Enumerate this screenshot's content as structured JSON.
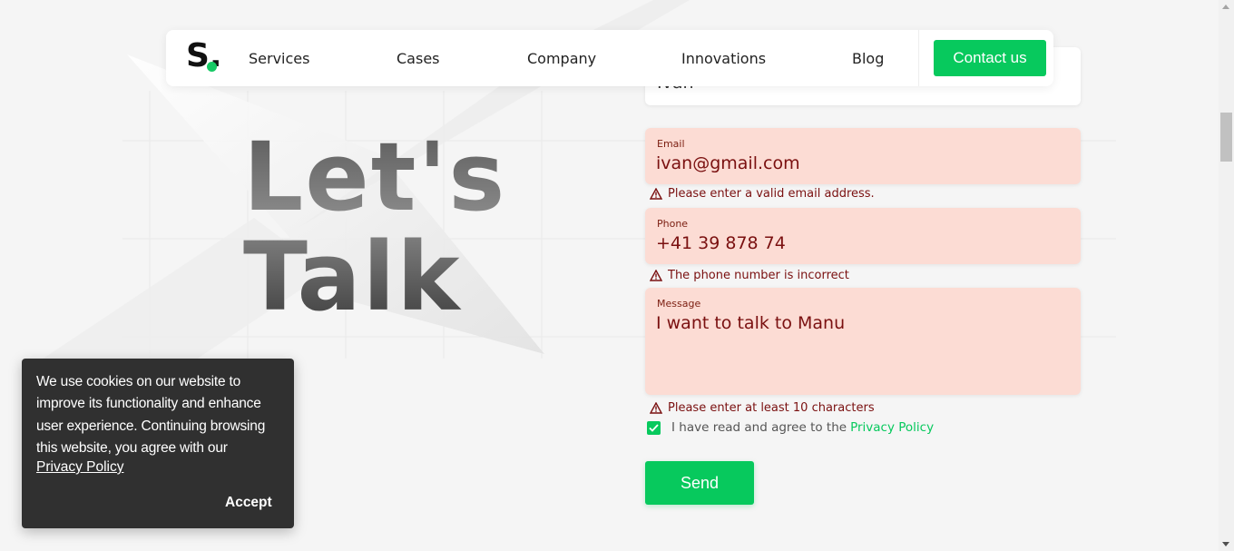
{
  "colors": {
    "accent": "#07c95d",
    "error_bg": "#fcdcd4",
    "error_text": "#7a1010",
    "cookie_bg": "#303030"
  },
  "nav": {
    "logo_letter": "S.",
    "links": [
      "Services",
      "Cases",
      "Company",
      "Innovations",
      "Blog"
    ],
    "contact_label": "Contact us"
  },
  "hero": {
    "line1": "Let's",
    "line2": "Talk"
  },
  "form": {
    "name_value": "Ivan",
    "email": {
      "label": "Email",
      "value": "ivan@gmail.com",
      "error": "Please enter a valid email address."
    },
    "phone": {
      "label": "Phone",
      "value": "+41 39 878 74",
      "error": "The phone number is incorrect"
    },
    "message": {
      "label": "Message",
      "value": "I want to talk to Manu",
      "error": "Please enter at least 10 characters"
    },
    "agree_text": "I have read and agree to the",
    "agree_link": "Privacy Policy",
    "agree_checked": true,
    "send_label": "Send"
  },
  "cookie": {
    "text": "We use cookies on our website to improve its functionality and enhance user experience. Continuing browsing this website, you agree with our",
    "link": "Privacy Policy",
    "accept": "Accept"
  }
}
